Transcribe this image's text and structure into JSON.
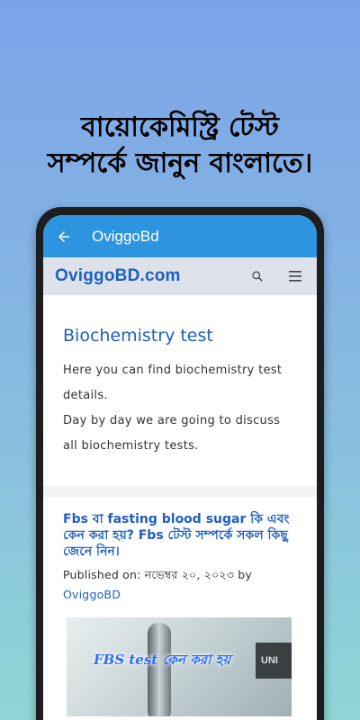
{
  "promo": {
    "line1": "বায়োকেমিস্ট্রি টেস্ট",
    "line2": "সম্পর্কে জানুন বাংলাতে।"
  },
  "appbar": {
    "title": "OviggoBd",
    "back_icon": "arrow-back-icon"
  },
  "site": {
    "logo": "OviggoBD.com",
    "search_icon": "search-icon",
    "menu_icon": "hamburger-menu-icon"
  },
  "page": {
    "heading": "Biochemistry test",
    "desc1": "Here you can find biochemistry test details.",
    "desc2": "Day by day we are going to discuss all biochemistry tests."
  },
  "post": {
    "title": "Fbs বা fasting blood sugar কি এবং কেন করা হয়? Fbs টেস্ট সম্পর্কে সকল কিছু জেনে নিন।",
    "meta_prefix": "Published on: নভেম্বর ২০, ২০২৩ by",
    "author": "OviggoBD",
    "image_caption": "FBS test কেন করা হয়",
    "image_label": "UNI"
  },
  "colors": {
    "appbar": "#2d94e0",
    "link": "#1f5fbf",
    "site_header": "#dde2ea"
  }
}
